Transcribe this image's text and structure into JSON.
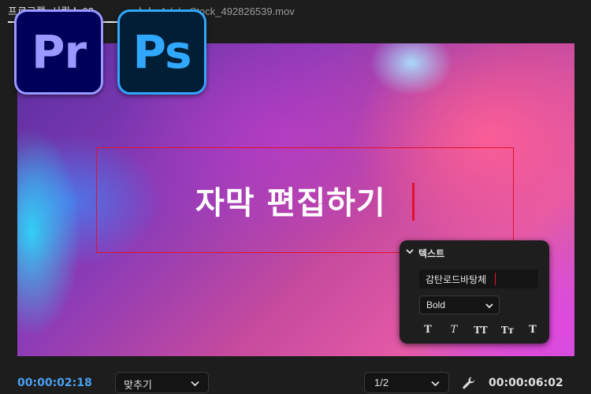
{
  "tabs": {
    "program": "프로그램: 시퀀스 03",
    "source": "소스: AdobeStock_492826539.mov"
  },
  "app_icons": {
    "premiere": "Pr",
    "photoshop": "Ps"
  },
  "video": {
    "title_text": "자막 편집하기"
  },
  "text_panel": {
    "title": "텍스트",
    "font_name": "감탄로드바탕체",
    "font_style": "Bold",
    "style_buttons": [
      "T",
      "T",
      "TT",
      "Tт",
      "T"
    ]
  },
  "bottom_bar": {
    "current_timecode": "00:00:02:18",
    "zoom": "맞추기",
    "resolution": "1/2",
    "duration_timecode": "00:00:06:02"
  },
  "colors": {
    "accent_blue": "#4aa0f0",
    "selection_red": "#e3122b",
    "premiere_purple": "#9999ff",
    "photoshop_blue": "#31a8ff"
  }
}
